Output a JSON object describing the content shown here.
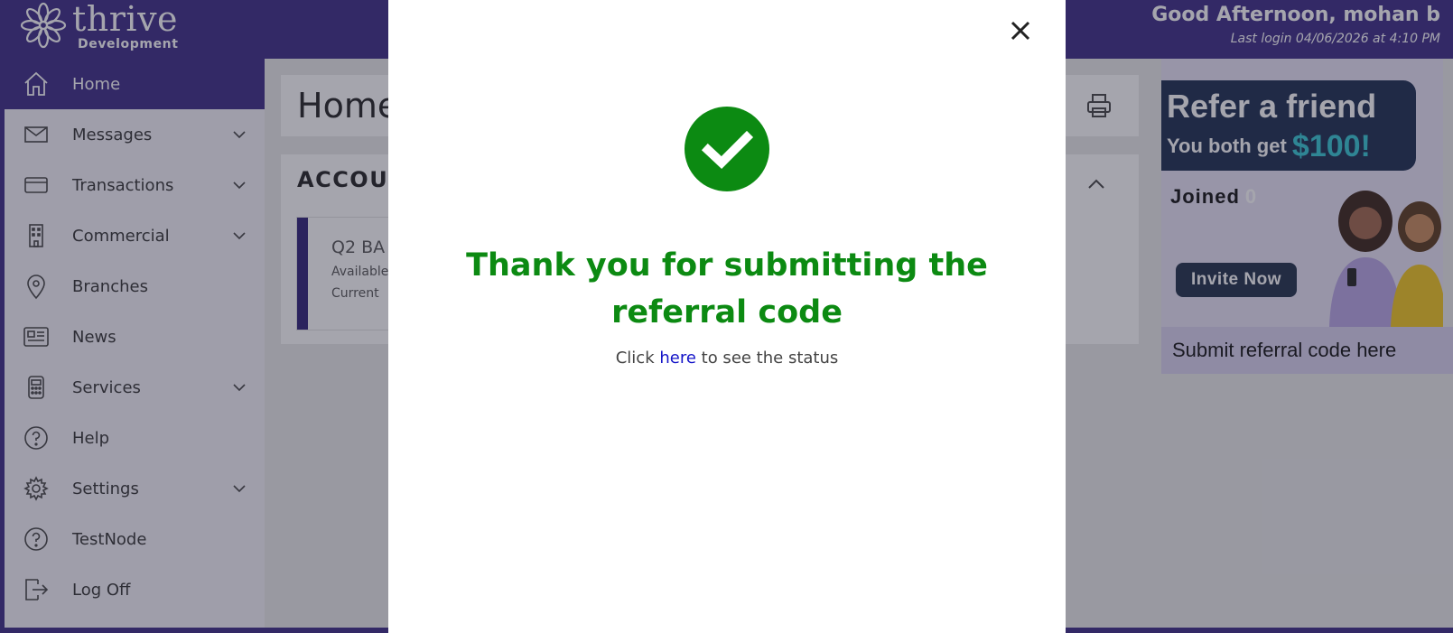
{
  "header": {
    "brand": "thrive",
    "brand_sub": "Development",
    "greeting": "Good Afternoon, mohan b",
    "last_login": "Last login 04/06/2026 at 4:10 PM"
  },
  "sidebar": {
    "items": [
      {
        "label": "Home",
        "icon": "home-icon",
        "active": true
      },
      {
        "label": "Messages",
        "icon": "envelope-icon",
        "expandable": true
      },
      {
        "label": "Transactions",
        "icon": "credit-card-icon",
        "expandable": true
      },
      {
        "label": "Commercial",
        "icon": "building-icon",
        "expandable": true
      },
      {
        "label": "Branches",
        "icon": "map-pin-icon"
      },
      {
        "label": "News",
        "icon": "newspaper-icon"
      },
      {
        "label": "Services",
        "icon": "calculator-icon",
        "expandable": true
      },
      {
        "label": "Help",
        "icon": "question-circle-icon"
      },
      {
        "label": "Settings",
        "icon": "gear-icon",
        "expandable": true
      },
      {
        "label": "TestNode",
        "icon": "question-circle-icon"
      },
      {
        "label": "Log Off",
        "icon": "log-off-icon"
      }
    ]
  },
  "main": {
    "title": "Home",
    "accounts_heading": "ACCOUN",
    "account": {
      "name": "Q2 BA",
      "available": "Available",
      "current": "Current"
    }
  },
  "promo": {
    "line1": "Refer a friend",
    "line2_prefix": "You both get ",
    "amount": "$100!",
    "joined_label": "Joined",
    "joined_count": "0",
    "invite_label": "Invite Now",
    "submit_label": "Submit referral code here"
  },
  "modal": {
    "title_line1": "Thank you for submitting the",
    "title_line2": "referral code",
    "sub_prefix": "Click ",
    "sub_link": "here",
    "sub_suffix": " to see the status"
  },
  "colors": {
    "brand": "#3b2a86",
    "success": "#0c8a12",
    "link": "#1414c8"
  }
}
